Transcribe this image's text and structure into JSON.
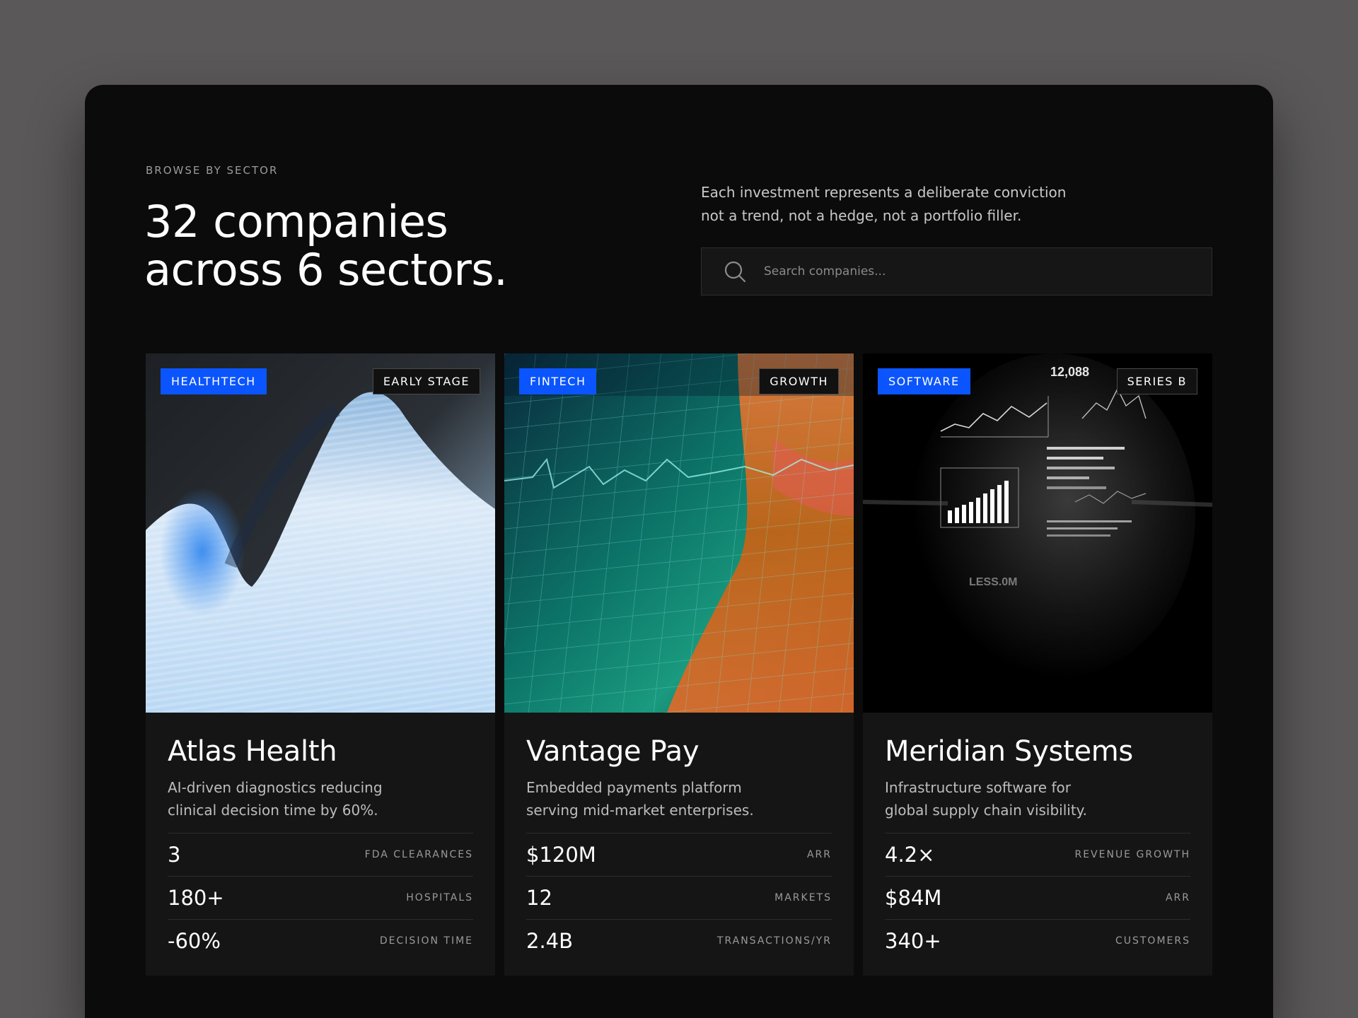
{
  "header": {
    "eyebrow": "BROWSE BY SECTOR",
    "headline_line1": "32 companies",
    "headline_line2": "across 6 sectors.",
    "intro_line1": "Each investment represents a deliberate conviction",
    "intro_line2": "not a trend, not a hedge, not a portfolio filler."
  },
  "search": {
    "placeholder": "Search companies...",
    "value": "",
    "icon": "search-icon"
  },
  "colors": {
    "accent": "#0a55ff",
    "background": "#0b0b0b",
    "card": "#151515"
  },
  "cards": [
    {
      "sector": "HEALTHTECH",
      "stage": "EARLY STAGE",
      "title": "Atlas Health",
      "desc_line1": "AI-driven diagnostics reducing",
      "desc_line2": "clinical decision time by 60%.",
      "metrics": [
        {
          "value": "3",
          "label": "FDA CLEARANCES"
        },
        {
          "value": "180+",
          "label": "HOSPITALS"
        },
        {
          "value": "-60%",
          "label": "DECISION TIME"
        }
      ]
    },
    {
      "sector": "FINTECH",
      "stage": "GROWTH",
      "title": "Vantage Pay",
      "desc_line1": "Embedded payments platform",
      "desc_line2": "serving mid-market enterprises.",
      "metrics": [
        {
          "value": "$120M",
          "label": "ARR"
        },
        {
          "value": "12",
          "label": "MARKETS"
        },
        {
          "value": "2.4B",
          "label": "TRANSACTIONS/YR"
        }
      ]
    },
    {
      "sector": "SOFTWARE",
      "stage": "SERIES B",
      "title": "Meridian Systems",
      "desc_line1": "Infrastructure software for",
      "desc_line2": "global supply chain visibility.",
      "image_labels": [
        "12,088",
        "LESS.0M"
      ],
      "metrics": [
        {
          "value": "4.2×",
          "label": "REVENUE GROWTH"
        },
        {
          "value": "$84M",
          "label": "ARR"
        },
        {
          "value": "340+",
          "label": "CUSTOMERS"
        }
      ]
    }
  ]
}
